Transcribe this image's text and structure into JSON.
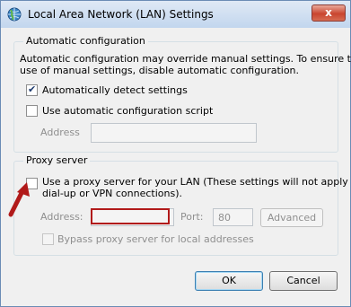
{
  "window": {
    "title": "Local Area Network (LAN) Settings",
    "close_glyph": "x"
  },
  "auto_config": {
    "group_title": "Automatic configuration",
    "description_line1": "Automatic configuration may override manual settings.  To ensure the",
    "description_line2": "use of manual settings, disable automatic configuration.",
    "detect_label": "Automatically detect settings",
    "detect_checked": true,
    "script_label": "Use automatic configuration script",
    "script_checked": false,
    "address_label": "Address",
    "address_value": ""
  },
  "proxy": {
    "group_title": "Proxy server",
    "use_proxy_line1": "Use a proxy server for your LAN (These settings will not apply to",
    "use_proxy_line2": "dial-up or VPN connections).",
    "use_proxy_checked": false,
    "address_label": "Address:",
    "address_value": "",
    "port_label": "Port:",
    "port_value": "80",
    "advanced_label": "Advanced",
    "bypass_label": "Bypass proxy server for local addresses",
    "bypass_checked": false
  },
  "buttons": {
    "ok_label": "OK",
    "cancel_label": "Cancel"
  },
  "annotation": {
    "arrow_color": "#b11a1a",
    "highlight_color": "#b11a1a"
  },
  "icons": {
    "title": "network-globe-icon",
    "arrow": "red-arrow-icon"
  }
}
